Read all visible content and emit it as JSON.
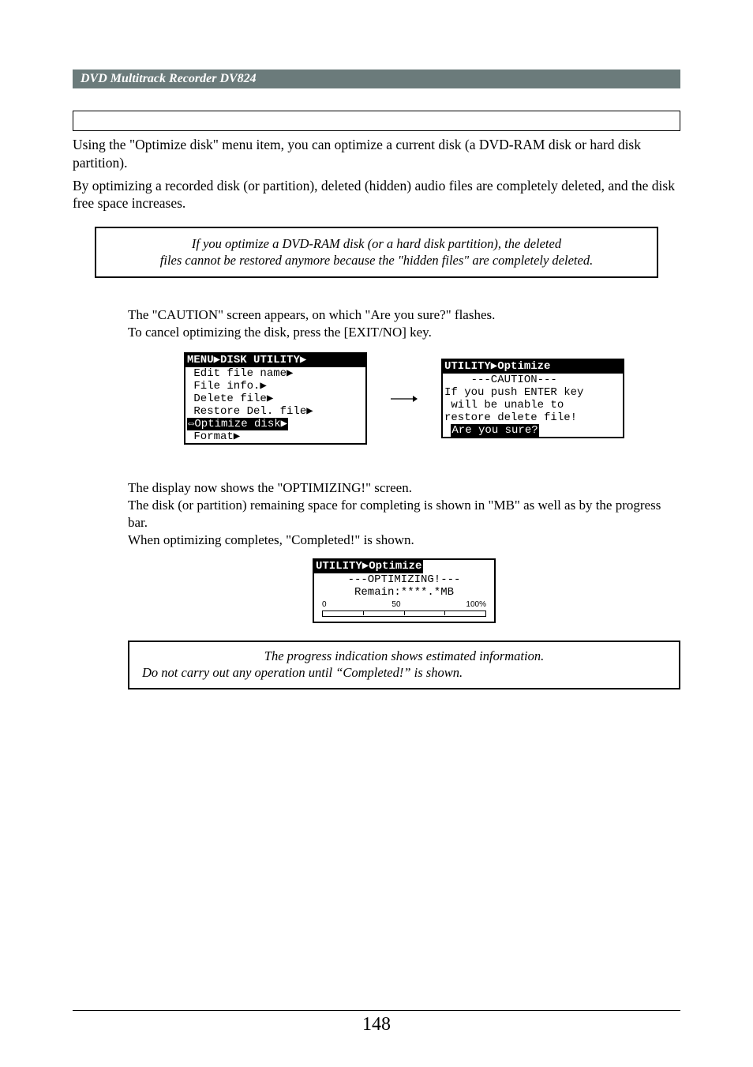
{
  "header": {
    "title": "DVD Multitrack Recorder DV824"
  },
  "intro": {
    "p1": "Using the \"Optimize disk\" menu item, you can optimize a current disk (a DVD-RAM disk or hard disk partition).",
    "p2": "By optimizing a recorded disk (or partition), deleted (hidden) audio files are completely deleted, and the disk free space increases."
  },
  "caution": {
    "line1": "If you optimize a DVD-RAM disk (or a hard disk partition), the deleted",
    "line2": "files cannot be restored anymore because the \"hidden files\" are completely deleted."
  },
  "step1": {
    "l1": "The \"CAUTION\" screen appears, on which \"Are you sure?\" flashes.",
    "l2": "To cancel optimizing the disk, press the [EXIT/NO] key."
  },
  "lcd1": {
    "title": "MENU▶DISK UTILITY▶",
    "l1": " Edit file name▶",
    "l2": " File info.▶",
    "l3": " Delete file▶",
    "l4": " Restore Del. file▶",
    "l5_inv": "⇔Optimize disk▶",
    "l6": " Format▶"
  },
  "lcd2": {
    "title": "UTILITY▶Optimize",
    "l1": "    ---CAUTION---",
    "l2": "If you push ENTER key",
    "l3": " will be unable to",
    "l4": "restore delete file!",
    "l5": "",
    "l6_inv": "Are you sure?"
  },
  "step2": {
    "l1": "The display now shows the \"OPTIMIZING!\" screen.",
    "l2": "The disk (or partition) remaining space for completing is shown in \"MB\" as well as by the progress bar.",
    "l3": "When optimizing completes, \"Completed!\" is shown."
  },
  "lcd3": {
    "title": "UTILITY▶Optimize",
    "l1": "---OPTIMIZING!---",
    "l2": "Remain:****.*MB",
    "p0": "0",
    "p50": "50",
    "p100": "100%"
  },
  "note": {
    "l1": "The progress indication shows estimated information.",
    "l2": "Do not carry out  any operation until “Completed!” is shown."
  },
  "pageNumber": "148"
}
